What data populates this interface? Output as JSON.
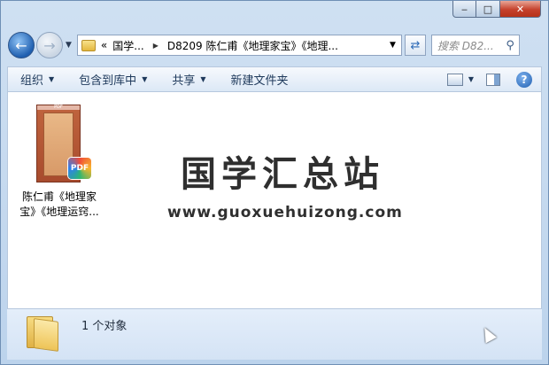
{
  "window": {
    "minimize_glyph": "‒",
    "maximize_glyph": "□",
    "close_glyph": "✕"
  },
  "nav": {
    "back_glyph": "←",
    "forward_glyph": "→",
    "breadcrumb": [
      "«",
      "国学...",
      "D8209 陈仁甫《地理家宝》《地理..."
    ],
    "search_placeholder": "搜索 D82...",
    "search_icon": "magnifier-icon"
  },
  "toolbar": {
    "organize": "组织",
    "include_library": "包含到库中",
    "share": "共享",
    "new_folder": "新建文件夹"
  },
  "files": [
    {
      "name_line1": "陈仁甫《地理家",
      "name_line2": "宝》《地理运窍...",
      "badge": "PDF",
      "thumb_label": "PDF"
    }
  ],
  "watermark": {
    "title": "国学汇总站",
    "url": "www.guoxuehuizong.com"
  },
  "details": {
    "count_text": "1 个对象"
  },
  "colors": {
    "accent": "#1f5fb0",
    "close": "#c5412c"
  }
}
